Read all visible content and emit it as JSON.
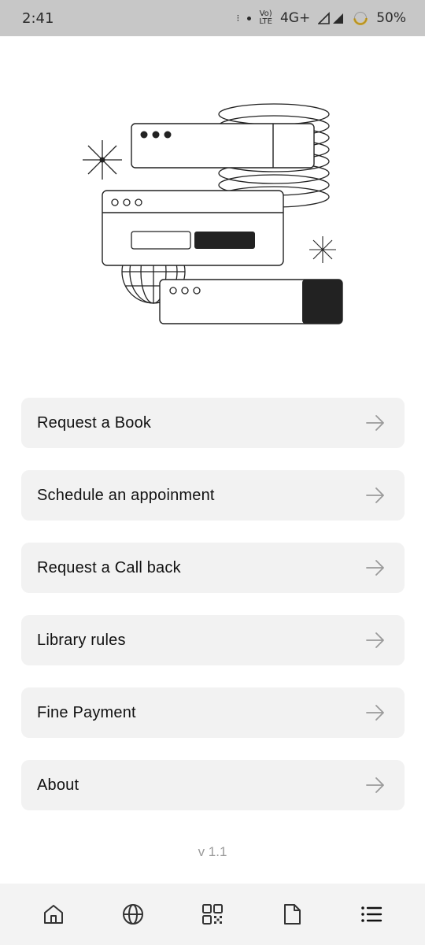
{
  "status_bar": {
    "time": "2:41",
    "volte_top": "Vo)",
    "volte_bottom": "LTE",
    "network": "4G+",
    "battery": "50%"
  },
  "hero": {
    "icon": "browser-windows-illustration"
  },
  "menu": {
    "items": [
      {
        "label": "Request a Book",
        "icon": "arrow-right-icon"
      },
      {
        "label": "Schedule an appoinment",
        "icon": "arrow-right-icon"
      },
      {
        "label": "Request a Call back",
        "icon": "arrow-right-icon"
      },
      {
        "label": "Library rules",
        "icon": "arrow-right-icon"
      },
      {
        "label": "Fine Payment",
        "icon": "arrow-right-icon"
      },
      {
        "label": "About",
        "icon": "arrow-right-icon"
      }
    ]
  },
  "version": "v 1.1",
  "bottom_nav": {
    "items": [
      {
        "icon": "home-icon"
      },
      {
        "icon": "globe-icon"
      },
      {
        "icon": "qr-code-icon"
      },
      {
        "icon": "document-icon"
      },
      {
        "icon": "menu-list-icon"
      }
    ]
  },
  "colors": {
    "card_bg": "#f2f2f2",
    "status_bar_bg": "#c7c7c7",
    "nav_bg": "#f3f3f3",
    "text": "#111111",
    "muted": "#9a9a9a"
  }
}
